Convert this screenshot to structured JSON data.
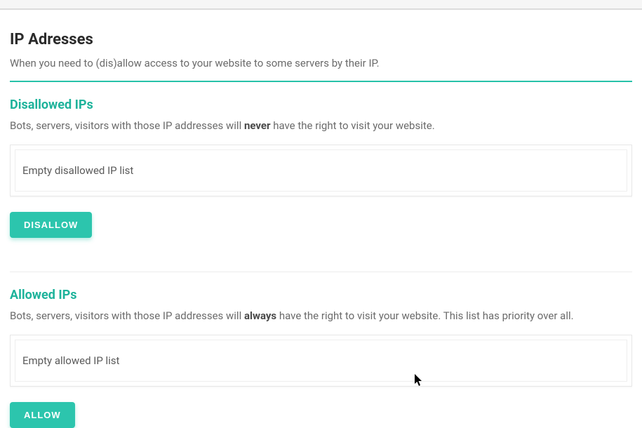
{
  "page": {
    "title": "IP Adresses",
    "subtitle": "When you need to (dis)allow access to your website to some servers by their IP."
  },
  "disallowed": {
    "heading": "Disallowed IPs",
    "desc_prefix": "Bots, servers, visitors with those IP addresses will ",
    "desc_strong": "never",
    "desc_suffix": " have the right to visit your website.",
    "empty_label": "Empty disallowed IP list",
    "button_label": "DISALLOW"
  },
  "allowed": {
    "heading": "Allowed IPs",
    "desc_prefix": "Bots, servers, visitors with those IP addresses will ",
    "desc_strong": "always",
    "desc_suffix": " have the right to visit your website. This list has priority over all.",
    "empty_label": "Empty allowed IP list",
    "button_label": "ALLOW"
  }
}
